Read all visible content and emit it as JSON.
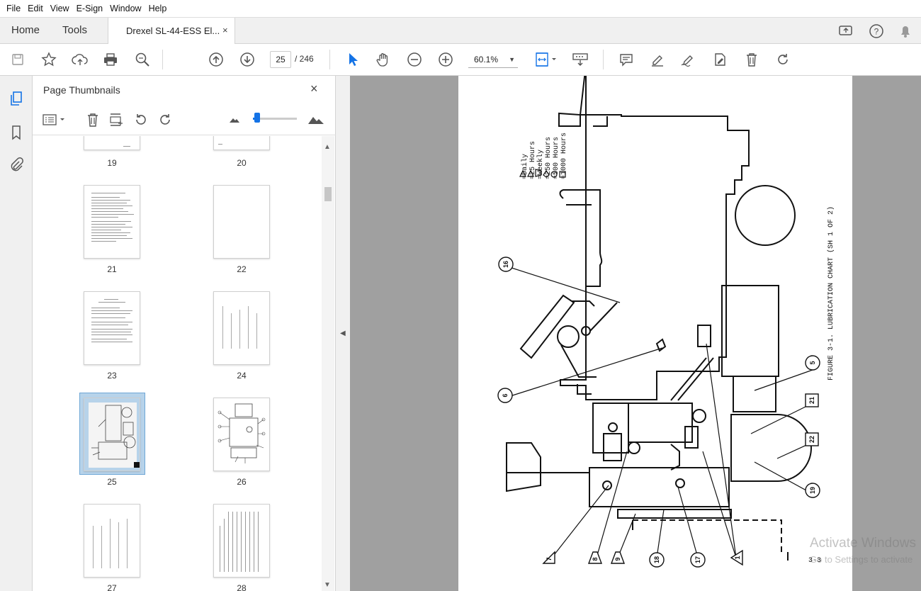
{
  "menubar": {
    "items": [
      "File",
      "Edit",
      "View",
      "E-Sign",
      "Window",
      "Help"
    ]
  },
  "tabs": {
    "home": "Home",
    "tools": "Tools",
    "document": "Drexel SL-44-ESS El...",
    "close": "×"
  },
  "toolbar": {
    "page_current": "25",
    "page_total": "/  246",
    "zoom": "60.1%",
    "zoom_caret": "▼"
  },
  "panel": {
    "title": "Page Thumbnails",
    "close": "×",
    "thumbnails": [
      {
        "label": "19"
      },
      {
        "label": "20"
      },
      {
        "label": "21"
      },
      {
        "label": "22"
      },
      {
        "label": "23"
      },
      {
        "label": "24"
      },
      {
        "label": "25",
        "selected": true
      },
      {
        "label": "26"
      },
      {
        "label": "27"
      },
      {
        "label": "28"
      }
    ],
    "size_slider_value": 0.1
  },
  "document": {
    "legend": [
      "=Daily",
      "=25 Hours",
      "=Weekly",
      "=250 Hours",
      "=500 Hours",
      "=1000 Hours"
    ],
    "caption": "FIGURE 3-1.  LUBRICATION CHART (SH 1 OF 2)",
    "callouts": [
      "16",
      "6",
      "5",
      "21",
      "22",
      "19",
      "7",
      "8",
      "9",
      "18",
      "17",
      "1"
    ],
    "page_number": "3-3"
  },
  "watermark": {
    "line1": "Activate Windows",
    "line2": "Go to Settings to activate"
  },
  "colors": {
    "accent": "#1473e6",
    "doc_bg": "#a0a0a0",
    "selected_thumb": "#b7d3ea"
  }
}
